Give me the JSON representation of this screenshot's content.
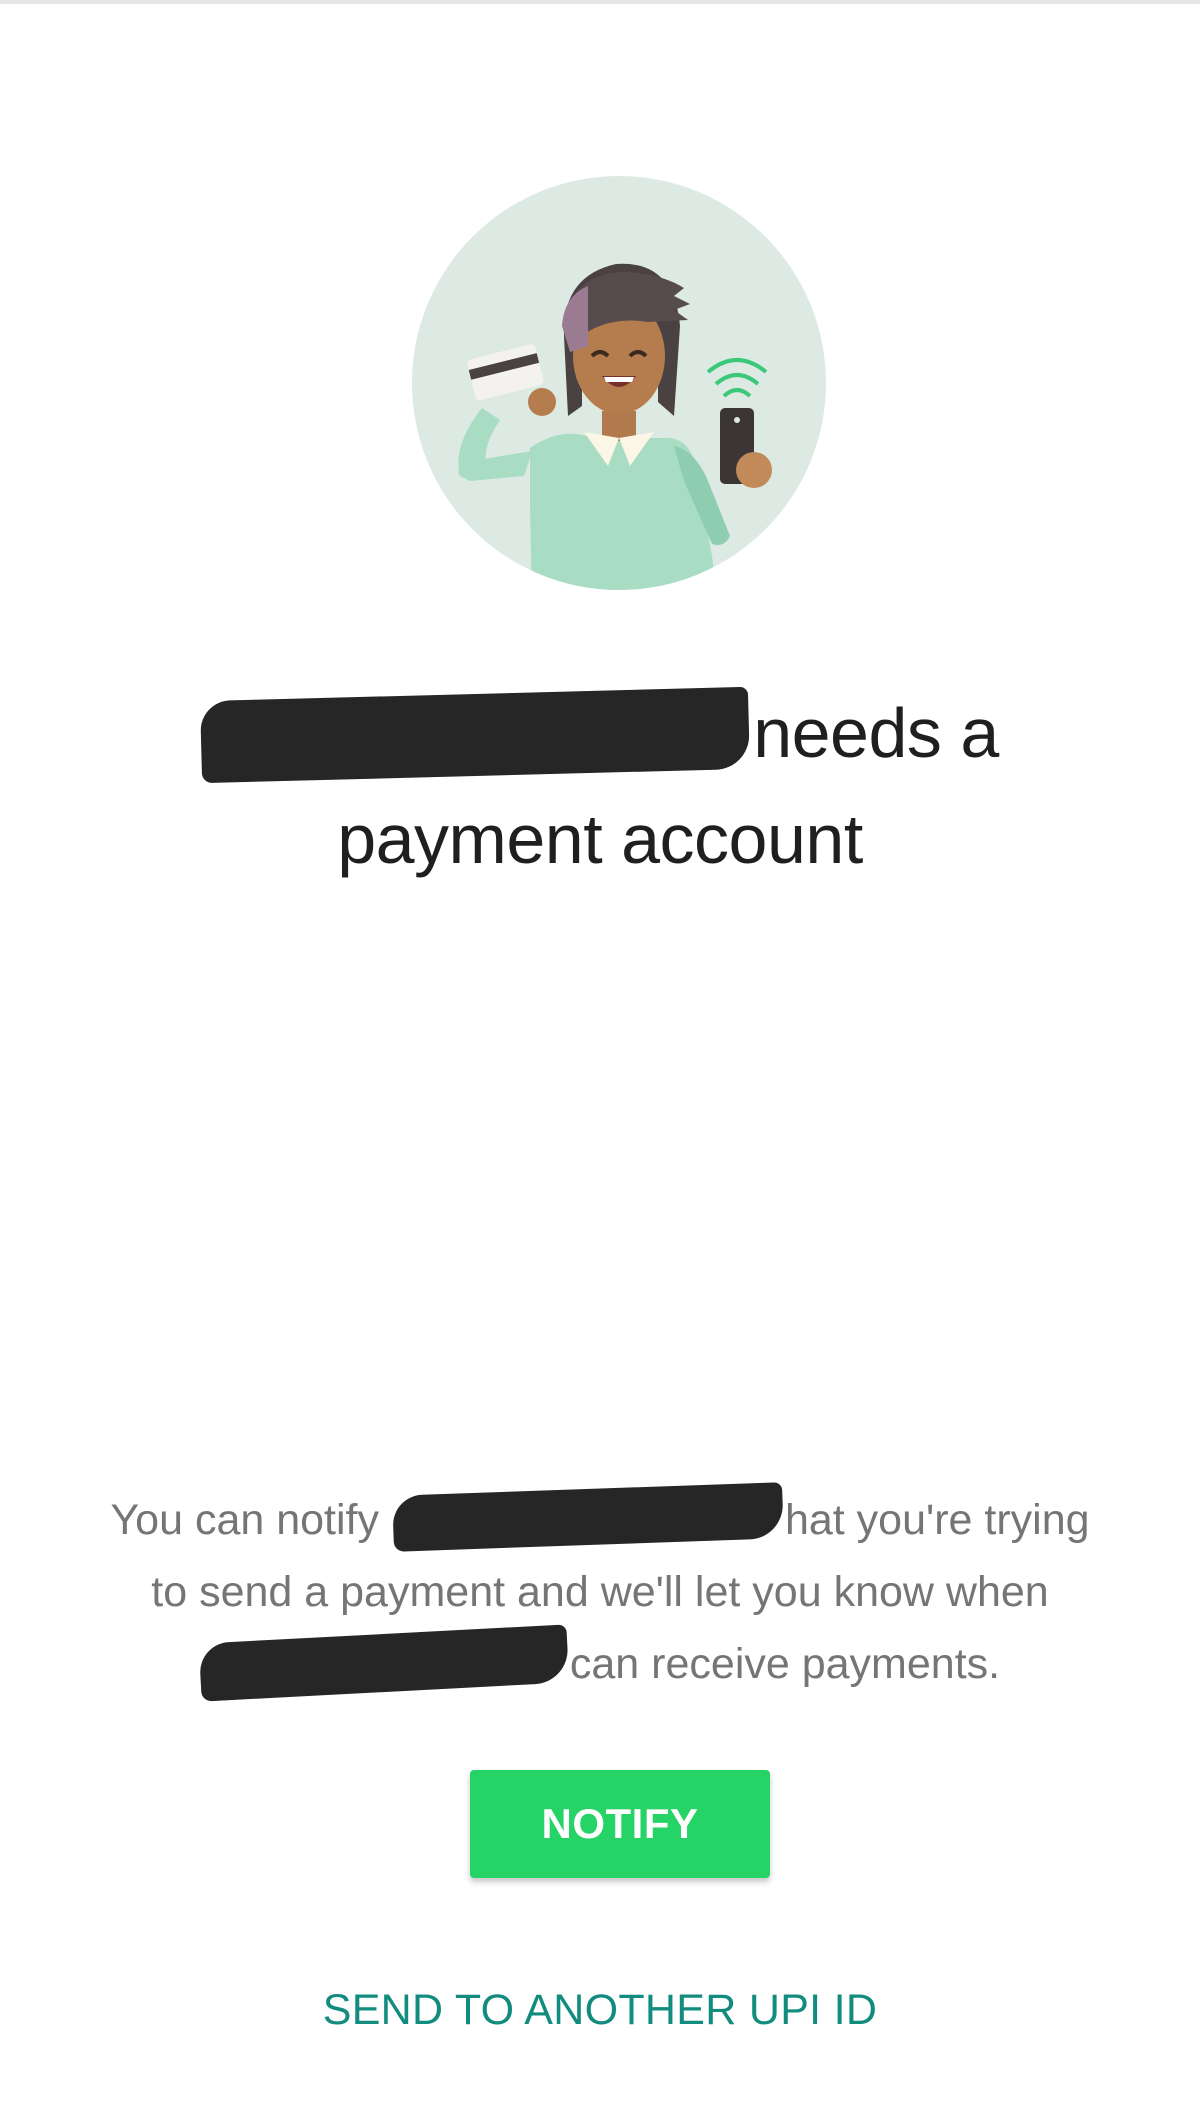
{
  "headline": {
    "line1_suffix": "needs a",
    "line2": "payment account"
  },
  "body": {
    "line1_prefix": "You can notify",
    "line1_suffix": "hat you're trying",
    "line2": "to send a payment and we'll let you know when",
    "line3_suffix": "can receive payments."
  },
  "actions": {
    "notify_label": "NOTIFY",
    "send_other_label": "SEND TO ANOTHER UPI ID"
  },
  "colors": {
    "accent_green": "#25d366",
    "link_teal": "#128c7e",
    "illustration_bg": "#dceae3"
  }
}
